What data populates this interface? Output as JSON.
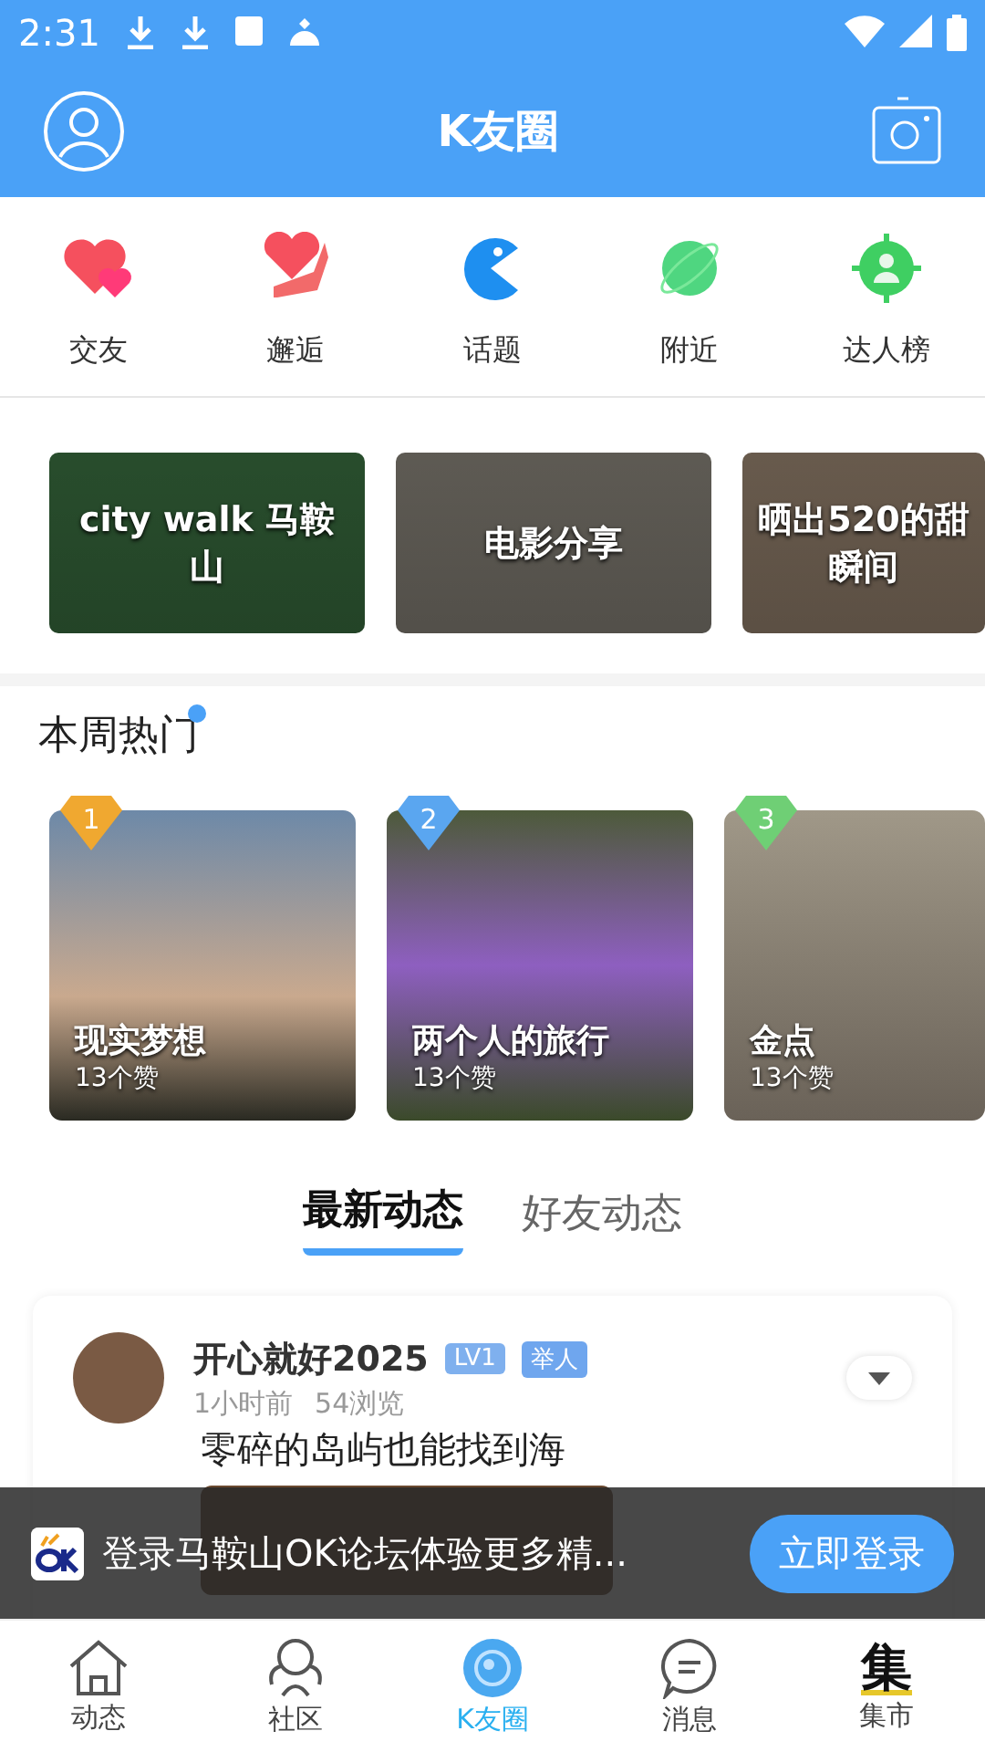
{
  "status_bar": {
    "time": "2:31"
  },
  "header": {
    "title": "K友圈"
  },
  "quick_nav": [
    {
      "label": "交友",
      "kind": "hearts"
    },
    {
      "label": "邂逅",
      "kind": "hand-heart"
    },
    {
      "label": "话题",
      "kind": "chomp"
    },
    {
      "label": "附近",
      "kind": "planet"
    },
    {
      "label": "达人榜",
      "kind": "target"
    }
  ],
  "banners": [
    {
      "title": "city walk 马鞍山",
      "color": "#2f5a34"
    },
    {
      "title": "电影分享",
      "color": "#6e6a62"
    },
    {
      "title": "晒出520的甜瞬间",
      "color": "#7a6a5a"
    }
  ],
  "hot": {
    "title": "本周热门",
    "items": [
      {
        "rank": "1",
        "title": "现实梦想",
        "likes": "13个赞",
        "color": "#f0a830"
      },
      {
        "rank": "2",
        "title": "两个人的旅行",
        "likes": "13个赞",
        "color": "#5aa6f0"
      },
      {
        "rank": "3",
        "title": "金点",
        "likes": "13个赞",
        "color": "#6fcf75"
      }
    ]
  },
  "feed_tabs": [
    {
      "label": "最新动态",
      "selected": true
    },
    {
      "label": "好友动态",
      "selected": false
    }
  ],
  "post": {
    "author": "开心就好2025",
    "level": "LV1",
    "rank_title": "举人",
    "time": "1小时前",
    "views": "54浏览",
    "text": "零碎的岛屿也能找到海"
  },
  "login_banner": {
    "message": "登录马鞍山OK论坛体验更多精...",
    "button": "立即登录"
  },
  "bottom_nav": [
    {
      "label": "动态",
      "kind": "home",
      "selected": false
    },
    {
      "label": "社区",
      "kind": "community",
      "selected": false
    },
    {
      "label": "K友圈",
      "kind": "circle",
      "selected": true
    },
    {
      "label": "消息",
      "kind": "chat",
      "selected": false
    },
    {
      "label": "集市",
      "kind": "market",
      "glyph": "集",
      "selected": false
    }
  ]
}
